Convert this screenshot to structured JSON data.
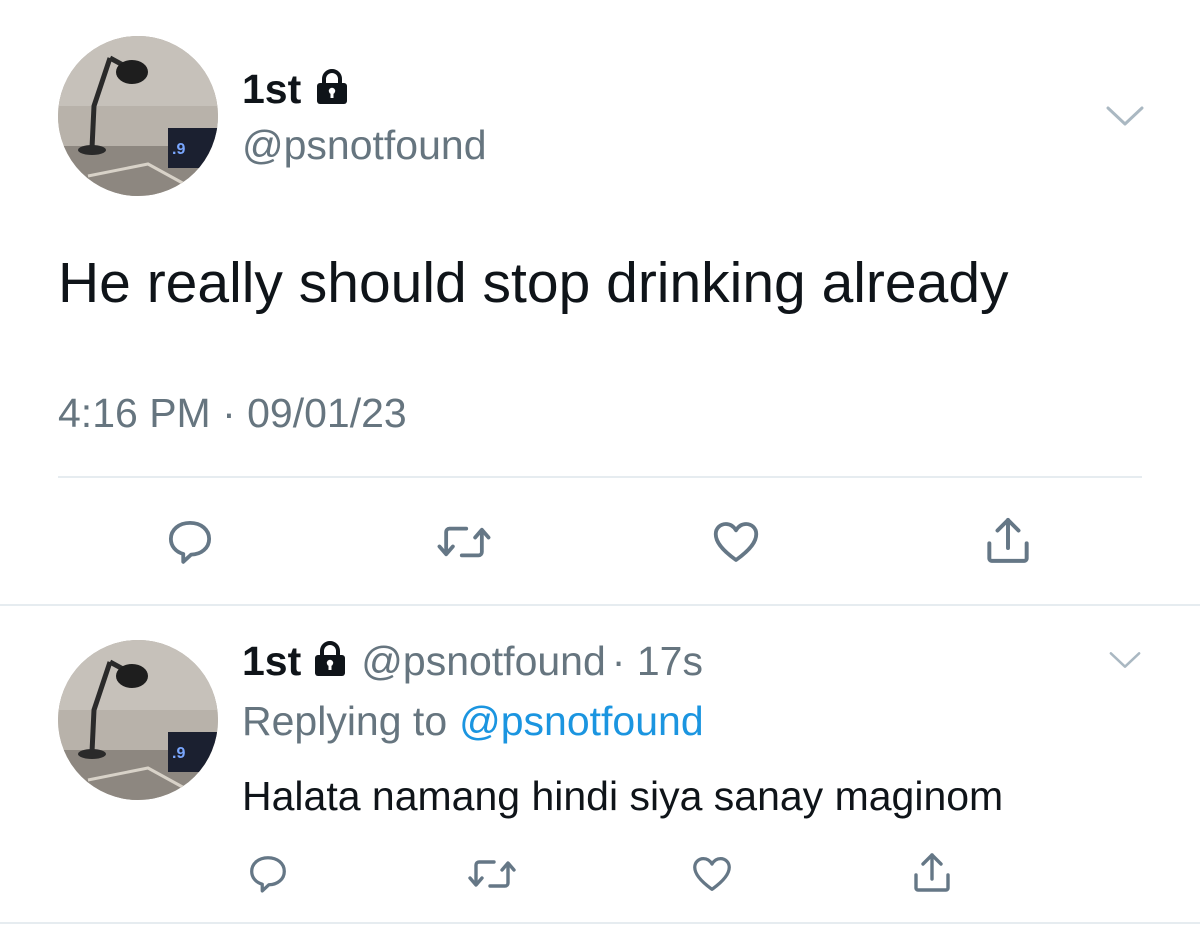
{
  "tweet": {
    "author": {
      "name": "1st",
      "handle": "@psnotfound"
    },
    "text": "He really should stop drinking already",
    "timestamp": "4:16 PM · 09/01/23",
    "actions": [
      {
        "name": "reply",
        "icon": "reply-icon"
      },
      {
        "name": "retweet",
        "icon": "retweet-icon"
      },
      {
        "name": "like",
        "icon": "heart-icon"
      },
      {
        "name": "share",
        "icon": "share-icon"
      }
    ]
  },
  "reply": {
    "author": {
      "name": "1st",
      "handle": "@psnotfound"
    },
    "age": "· 17s",
    "replying_prefix": "Replying to",
    "replying_to": "@psnotfound",
    "text": "Halata namang hindi siya sanay maginom"
  },
  "colors": {
    "text": "#0f1419",
    "muted": "#66757f",
    "link": "#1b95e0",
    "icon": "#657786",
    "divider": "#e6ecf0"
  }
}
